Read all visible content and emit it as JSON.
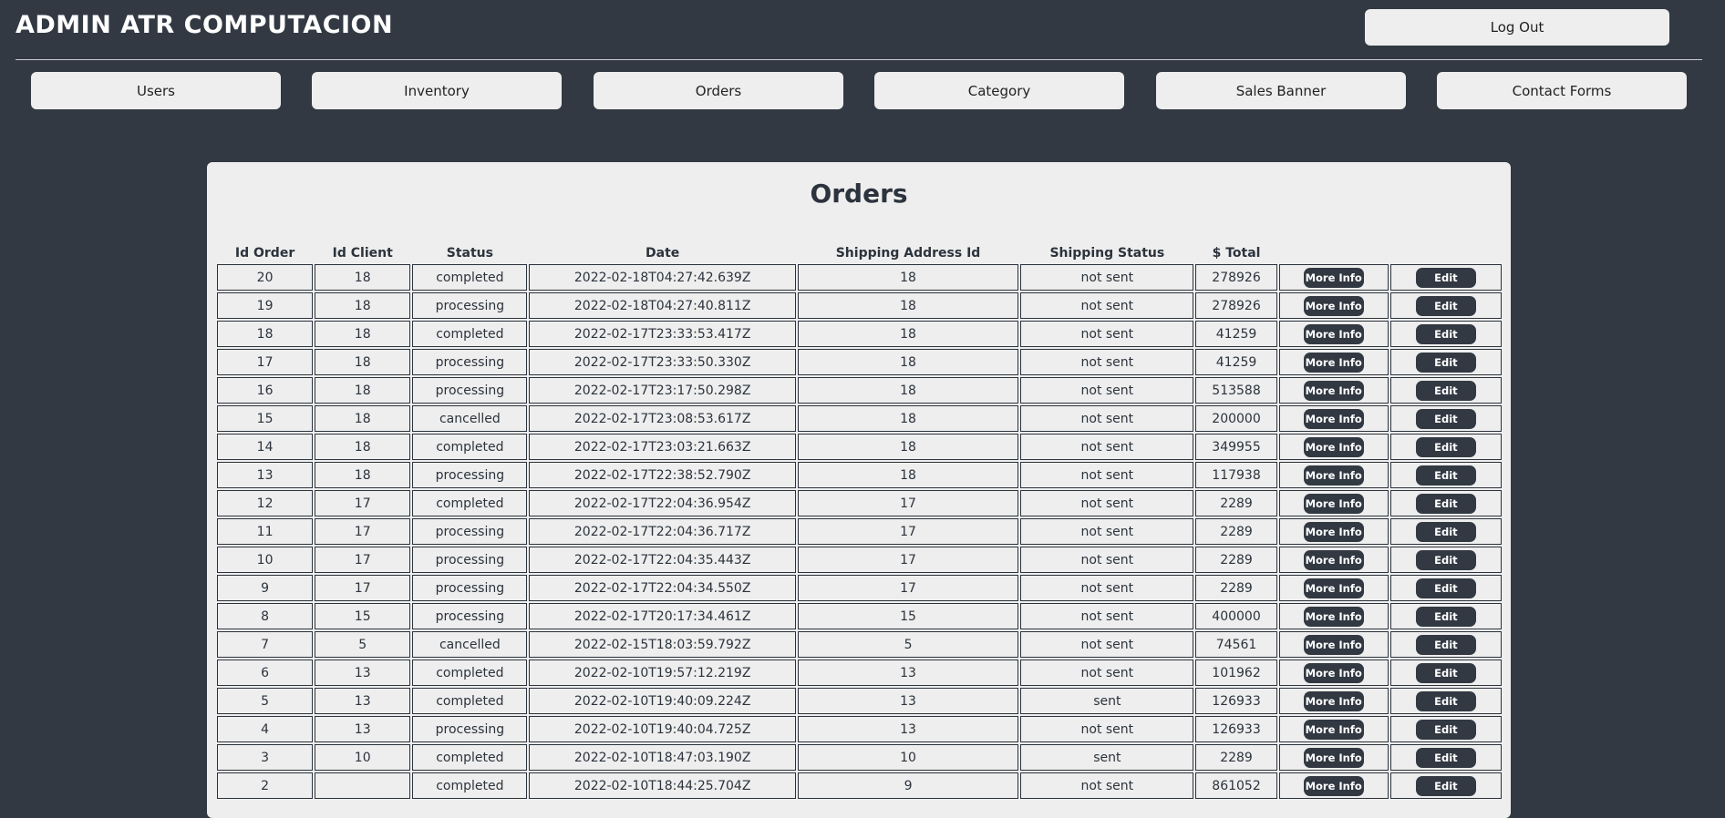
{
  "header": {
    "title": "ADMIN ATR COMPUTACION",
    "logout_label": "Log Out"
  },
  "nav": {
    "items": [
      {
        "label": "Users"
      },
      {
        "label": "Inventory"
      },
      {
        "label": "Orders"
      },
      {
        "label": "Category"
      },
      {
        "label": "Sales Banner"
      },
      {
        "label": "Contact Forms"
      }
    ]
  },
  "orders": {
    "title": "Orders",
    "columns": [
      "Id Order",
      "Id Client",
      "Status",
      "Date",
      "Shipping Address Id",
      "Shipping Status",
      "$ Total"
    ],
    "more_info_label": "More Info",
    "edit_label": "Edit",
    "rows": [
      {
        "id": "20",
        "client": "18",
        "status": "completed",
        "date": "2022-02-18T04:27:42.639Z",
        "address": "18",
        "shipping": "not sent",
        "total": "278926"
      },
      {
        "id": "19",
        "client": "18",
        "status": "processing",
        "date": "2022-02-18T04:27:40.811Z",
        "address": "18",
        "shipping": "not sent",
        "total": "278926"
      },
      {
        "id": "18",
        "client": "18",
        "status": "completed",
        "date": "2022-02-17T23:33:53.417Z",
        "address": "18",
        "shipping": "not sent",
        "total": "41259"
      },
      {
        "id": "17",
        "client": "18",
        "status": "processing",
        "date": "2022-02-17T23:33:50.330Z",
        "address": "18",
        "shipping": "not sent",
        "total": "41259"
      },
      {
        "id": "16",
        "client": "18",
        "status": "processing",
        "date": "2022-02-17T23:17:50.298Z",
        "address": "18",
        "shipping": "not sent",
        "total": "513588"
      },
      {
        "id": "15",
        "client": "18",
        "status": "cancelled",
        "date": "2022-02-17T23:08:53.617Z",
        "address": "18",
        "shipping": "not sent",
        "total": "200000"
      },
      {
        "id": "14",
        "client": "18",
        "status": "completed",
        "date": "2022-02-17T23:03:21.663Z",
        "address": "18",
        "shipping": "not sent",
        "total": "349955"
      },
      {
        "id": "13",
        "client": "18",
        "status": "processing",
        "date": "2022-02-17T22:38:52.790Z",
        "address": "18",
        "shipping": "not sent",
        "total": "117938"
      },
      {
        "id": "12",
        "client": "17",
        "status": "completed",
        "date": "2022-02-17T22:04:36.954Z",
        "address": "17",
        "shipping": "not sent",
        "total": "2289"
      },
      {
        "id": "11",
        "client": "17",
        "status": "processing",
        "date": "2022-02-17T22:04:36.717Z",
        "address": "17",
        "shipping": "not sent",
        "total": "2289"
      },
      {
        "id": "10",
        "client": "17",
        "status": "processing",
        "date": "2022-02-17T22:04:35.443Z",
        "address": "17",
        "shipping": "not sent",
        "total": "2289"
      },
      {
        "id": "9",
        "client": "17",
        "status": "processing",
        "date": "2022-02-17T22:04:34.550Z",
        "address": "17",
        "shipping": "not sent",
        "total": "2289"
      },
      {
        "id": "8",
        "client": "15",
        "status": "processing",
        "date": "2022-02-17T20:17:34.461Z",
        "address": "15",
        "shipping": "not sent",
        "total": "400000"
      },
      {
        "id": "7",
        "client": "5",
        "status": "cancelled",
        "date": "2022-02-15T18:03:59.792Z",
        "address": "5",
        "shipping": "not sent",
        "total": "74561"
      },
      {
        "id": "6",
        "client": "13",
        "status": "completed",
        "date": "2022-02-10T19:57:12.219Z",
        "address": "13",
        "shipping": "not sent",
        "total": "101962"
      },
      {
        "id": "5",
        "client": "13",
        "status": "completed",
        "date": "2022-02-10T19:40:09.224Z",
        "address": "13",
        "shipping": "sent",
        "total": "126933"
      },
      {
        "id": "4",
        "client": "13",
        "status": "processing",
        "date": "2022-02-10T19:40:04.725Z",
        "address": "13",
        "shipping": "not sent",
        "total": "126933"
      },
      {
        "id": "3",
        "client": "10",
        "status": "completed",
        "date": "2022-02-10T18:47:03.190Z",
        "address": "10",
        "shipping": "sent",
        "total": "2289"
      },
      {
        "id": "2",
        "client": "",
        "status": "completed",
        "date": "2022-02-10T18:44:25.704Z",
        "address": "9",
        "shipping": "not sent",
        "total": "861052"
      }
    ]
  }
}
